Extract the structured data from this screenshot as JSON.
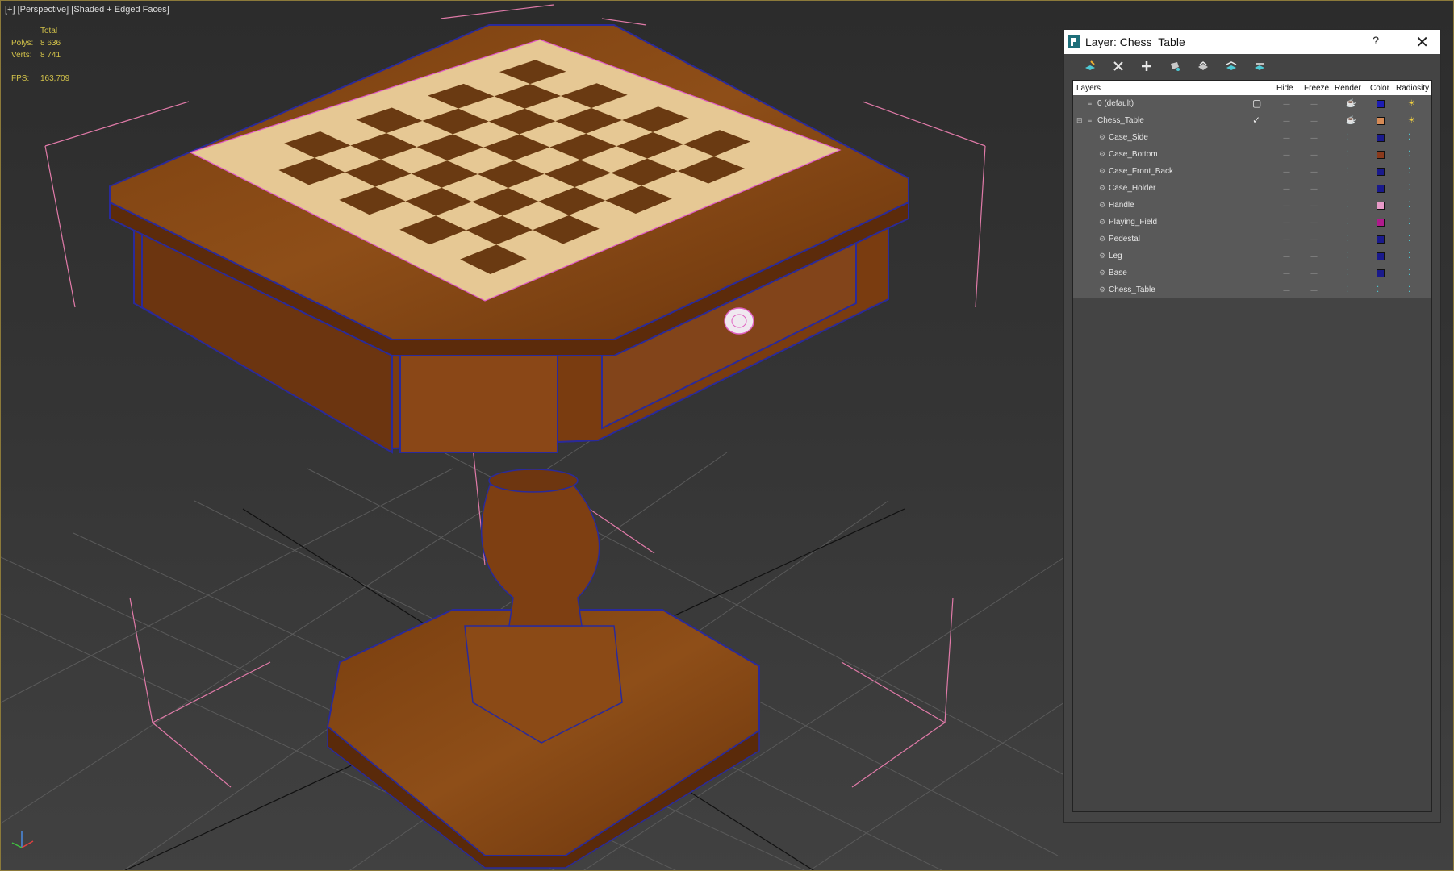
{
  "viewport": {
    "label_plus": "[+]",
    "label_view": "[Perspective]",
    "label_shading": "[Shaded + Edged Faces]",
    "stats": {
      "header": "Total",
      "polys_label": "Polys:",
      "polys_value": "8 636",
      "verts_label": "Verts:",
      "verts_value": "8 741",
      "fps_label": "FPS:",
      "fps_value": "163,709"
    }
  },
  "dialog": {
    "title": "Layer: Chess_Table",
    "help": "?",
    "close": "✕",
    "toolbar": [
      "create-layer-icon",
      "delete-layer-icon",
      "add-to-layer-icon",
      "select-in-layer-icon",
      "highlight-layer-icon",
      "hide-all-icon",
      "freeze-all-icon"
    ],
    "columns": {
      "layers": "Layers",
      "hide": "Hide",
      "freeze": "Freeze",
      "render": "Render",
      "color": "Color",
      "radiosity": "Radiosity"
    },
    "rows": [
      {
        "name": "0 (default)",
        "level": 0,
        "checked": false,
        "color": "#1c1cb4",
        "type": "layer"
      },
      {
        "name": "Chess_Table",
        "level": 0,
        "checked": true,
        "color": "#d68a55",
        "type": "layer"
      },
      {
        "name": "Case_Side",
        "level": 1,
        "color": "#1a1a8c",
        "type": "object"
      },
      {
        "name": "Case_Bottom",
        "level": 1,
        "color": "#8a3a1c",
        "type": "object"
      },
      {
        "name": "Case_Front_Back",
        "level": 1,
        "color": "#1a1a8c",
        "type": "object"
      },
      {
        "name": "Case_Holder",
        "level": 1,
        "color": "#1a1a8c",
        "type": "object"
      },
      {
        "name": "Handle",
        "level": 1,
        "color": "#e89ac8",
        "type": "object"
      },
      {
        "name": "Playing_Field",
        "level": 1,
        "color": "#b01a8c",
        "type": "object"
      },
      {
        "name": "Pedestal",
        "level": 1,
        "color": "#1a1a8c",
        "type": "object"
      },
      {
        "name": "Leg",
        "level": 1,
        "color": "#1a1a8c",
        "type": "object"
      },
      {
        "name": "Base",
        "level": 1,
        "color": "#1a1a8c",
        "type": "object"
      },
      {
        "name": "Chess_Table",
        "level": 1,
        "color": null,
        "type": "object"
      }
    ],
    "hide_glyph": "----",
    "freeze_glyph": "----"
  }
}
